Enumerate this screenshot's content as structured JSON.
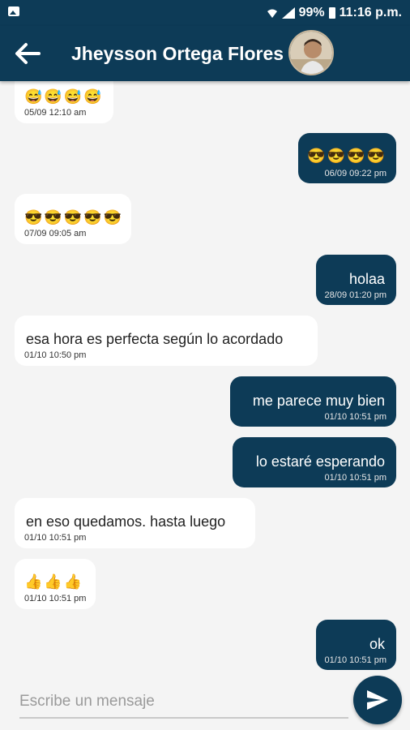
{
  "status_bar": {
    "battery": "99%",
    "time": "11:16 p.m."
  },
  "header": {
    "contact_name": "Jheysson Ortega Flores",
    "colors": {
      "primary": "#0d3b57"
    }
  },
  "messages": [
    {
      "side": "in",
      "emoji": "😅",
      "emoji_count": 4,
      "time": "05/09 12:10 am"
    },
    {
      "side": "out",
      "emoji": "😎",
      "emoji_count": 4,
      "time": "06/09 09:22 pm"
    },
    {
      "side": "in",
      "emoji": "😎",
      "emoji_count": 5,
      "time": "07/09 09:05 am"
    },
    {
      "side": "out",
      "text": "holaa",
      "time": "28/09 01:20 pm"
    },
    {
      "side": "in",
      "text": "esa hora es perfecta según lo acordado",
      "time": "01/10 10:50 pm"
    },
    {
      "side": "out",
      "text": "me parece muy bien",
      "time": "01/10 10:51 pm"
    },
    {
      "side": "out",
      "text": "lo estaré esperando",
      "time": "01/10 10:51 pm"
    },
    {
      "side": "in",
      "text": "en eso quedamos. hasta luego",
      "time": "01/10 10:51 pm"
    },
    {
      "side": "in",
      "emoji": "👍",
      "emoji_count": 3,
      "time": "01/10 10:51 pm"
    },
    {
      "side": "out",
      "text": "ok",
      "time": "01/10 10:51 pm"
    }
  ],
  "composer": {
    "placeholder": "Escribe un mensaje"
  }
}
